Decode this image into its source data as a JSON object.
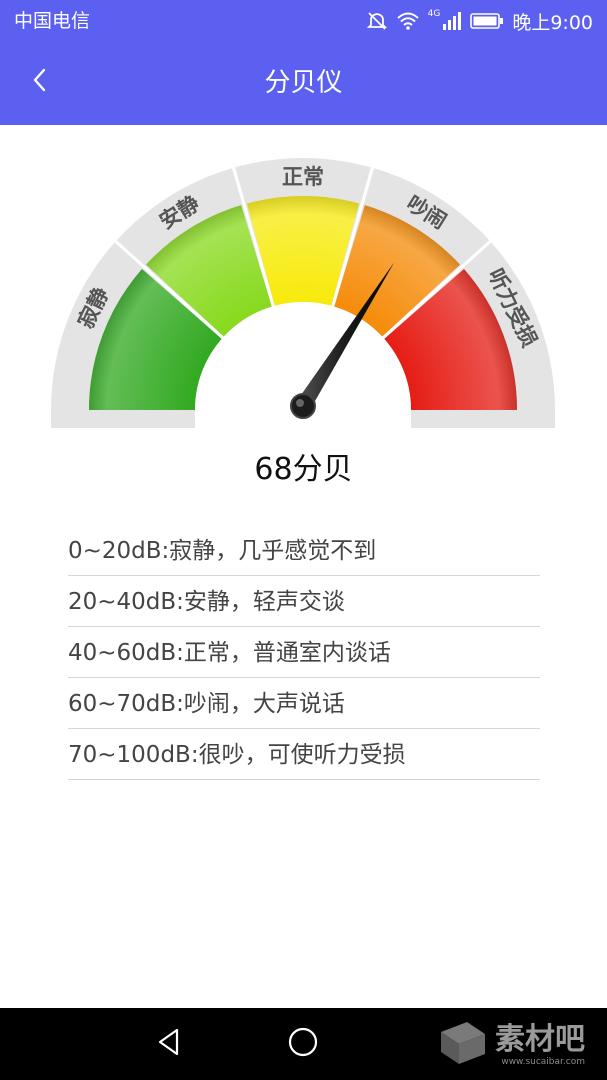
{
  "status_bar": {
    "carrier": "中国电信",
    "network": "4G",
    "time": "晚上9:00",
    "icons": [
      "mute-icon",
      "wifi-icon",
      "signal-icon",
      "battery-icon"
    ]
  },
  "toolbar": {
    "title": "分贝仪",
    "back_icon": "chevron-left-icon"
  },
  "gauge": {
    "value_db": 68,
    "scale_max_db": 100,
    "segments": [
      {
        "label": "寂静",
        "color": "#2fa81e"
      },
      {
        "label": "安静",
        "color": "#86d91a"
      },
      {
        "label": "正常",
        "color": "#f7ea08"
      },
      {
        "label": "吵闹",
        "color": "#f58a06"
      },
      {
        "label": "听力受损",
        "color": "#e51a12"
      }
    ],
    "needle_icon": "gauge-needle"
  },
  "reading": {
    "text": "68分贝"
  },
  "levels": [
    {
      "text": "0~20dB:寂静，几乎感觉不到"
    },
    {
      "text": "20~40dB:安静，轻声交谈"
    },
    {
      "text": "40~60dB:正常，普通室内谈话"
    },
    {
      "text": "60~70dB:吵闹，大声说话"
    },
    {
      "text": "70~100dB:很吵，可使听力受损"
    }
  ],
  "nav_bar": {
    "icons": [
      "back-triangle-icon",
      "home-circle-icon"
    ]
  },
  "watermark": {
    "text": "素材吧",
    "url": "www.sucaibar.com"
  }
}
